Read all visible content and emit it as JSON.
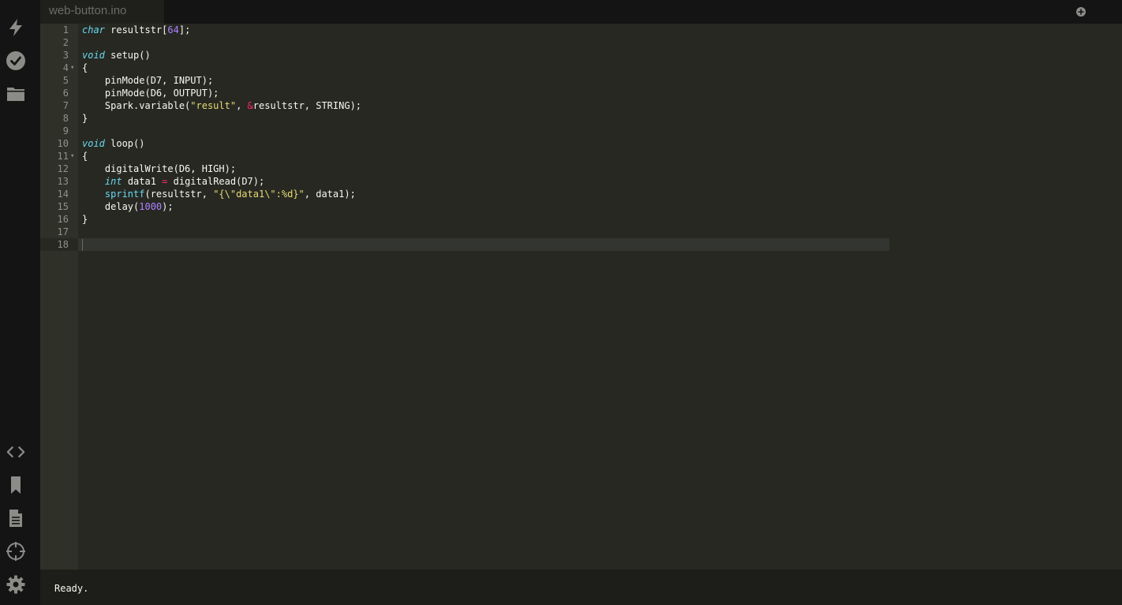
{
  "tab": {
    "filename": "web-button.ino"
  },
  "status": {
    "message": "Ready."
  },
  "sidebar": {
    "top_icons": [
      "flash-icon",
      "verify-icon",
      "folder-icon"
    ],
    "bottom_icons": [
      "code-icon",
      "bookmark-icon",
      "document-icon",
      "crosshair-icon",
      "gear-icon"
    ]
  },
  "editor": {
    "line_numbers": [
      "1",
      "2",
      "3",
      "4",
      "5",
      "6",
      "7",
      "8",
      "9",
      "10",
      "11",
      "12",
      "13",
      "14",
      "15",
      "16",
      "17",
      "18"
    ],
    "fold_marks": {
      "4": "▾",
      "11": "▾"
    },
    "code": {
      "l1": {
        "t1": "char",
        "t2": " resultstr[",
        "t3": "64",
        "t4": "];"
      },
      "l3": {
        "t1": "void",
        "t2": " setup()"
      },
      "l4": {
        "t1": "{"
      },
      "l5": {
        "t1": "    pinMode(D7, INPUT);"
      },
      "l6": {
        "t1": "    pinMode(D6, OUTPUT);"
      },
      "l7": {
        "t1": "    Spark.variable(",
        "t2": "\"result\"",
        "t3": ", ",
        "t4": "&",
        "t5": "resultstr, STRING);"
      },
      "l8": {
        "t1": "}"
      },
      "l10": {
        "t1": "void",
        "t2": " loop()"
      },
      "l11": {
        "t1": "{"
      },
      "l12": {
        "t1": "    digitalWrite(D6, HIGH);"
      },
      "l13": {
        "t0": "    ",
        "t1": "int",
        "t2": " data1 ",
        "t3": "=",
        "t4": " digitalRead(D7);"
      },
      "l14": {
        "t0": "    ",
        "t1": "sprintf",
        "t2": "(resultstr, ",
        "t3": "\"{\\\"data1\\\":%d}\"",
        "t4": ", data1);"
      },
      "l15": {
        "t1": "    delay(",
        "t2": "1000",
        "t3": ");"
      },
      "l16": {
        "t1": "}"
      }
    }
  },
  "colors": {
    "editor_bg": "#272822",
    "gutter_bg": "#2f3129",
    "keyword": "#66d9ef",
    "string": "#e6db74",
    "number": "#ae81ff",
    "operator": "#f92672"
  }
}
